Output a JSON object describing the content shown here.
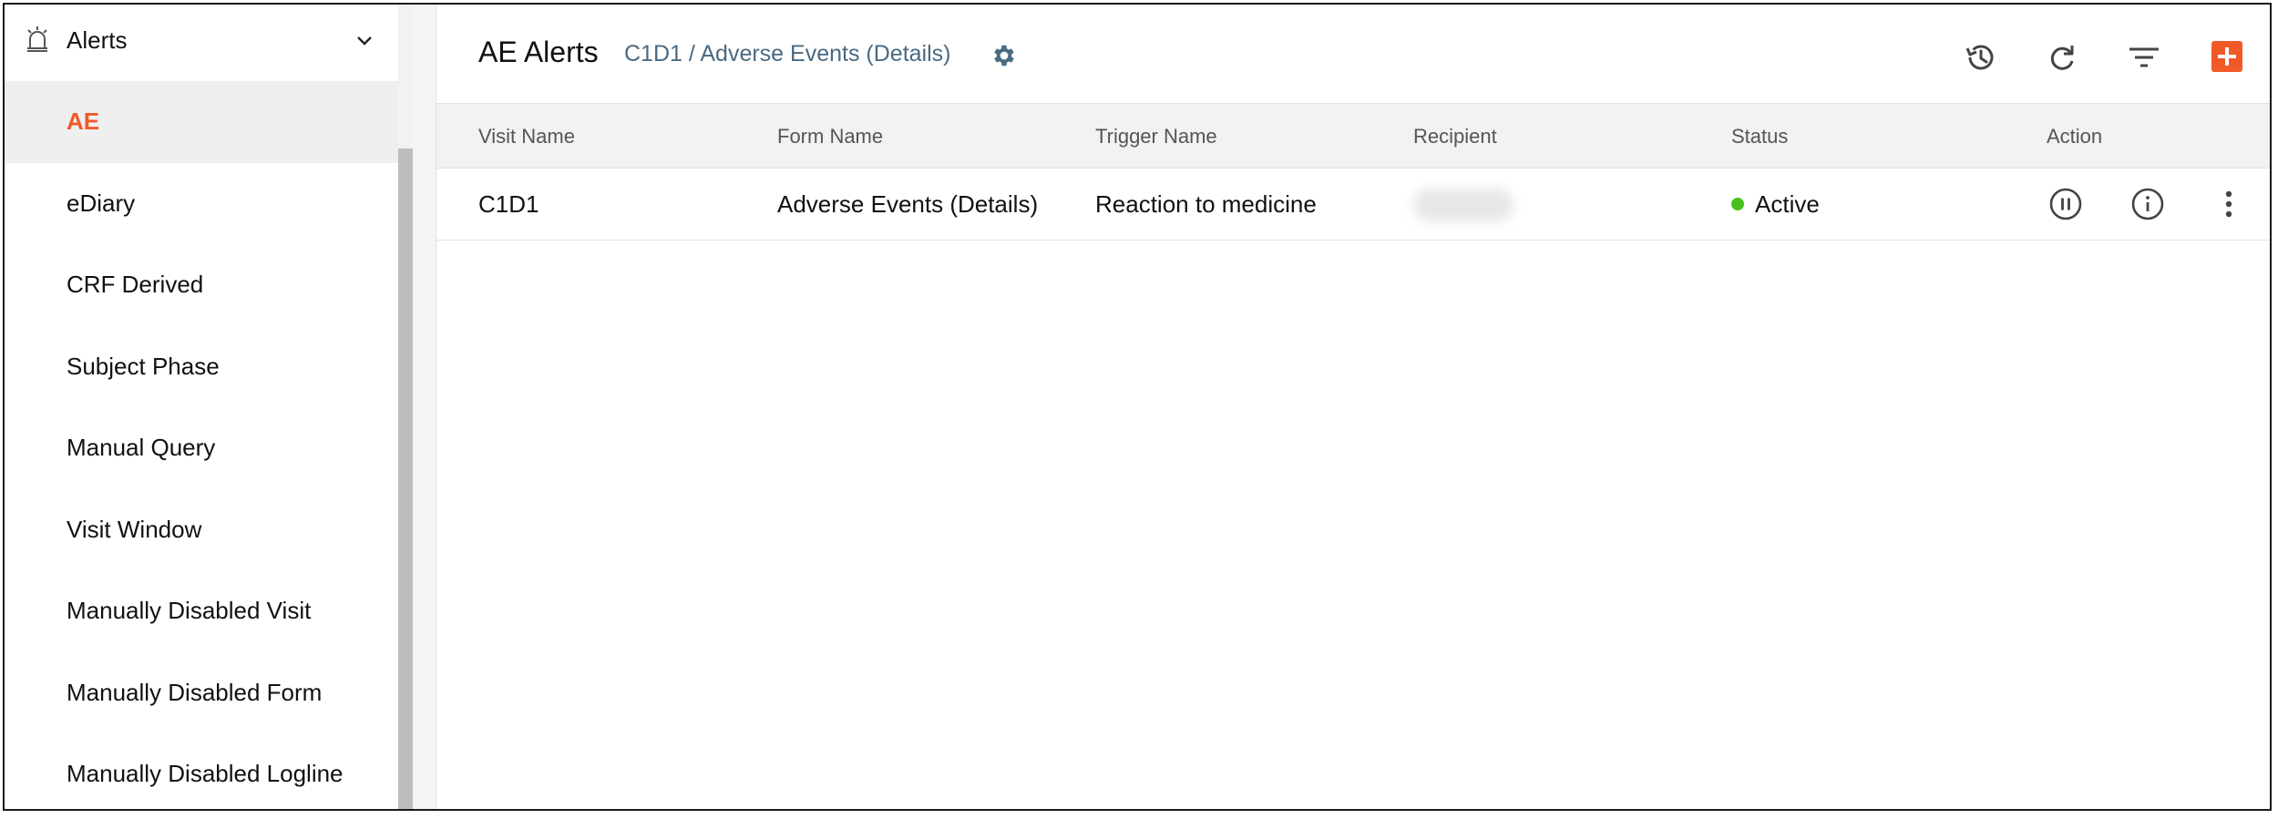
{
  "sidebar": {
    "header": {
      "title": "Alerts",
      "icon": "alarm-icon"
    },
    "items": [
      {
        "label": "AE",
        "active": true
      },
      {
        "label": "eDiary",
        "active": false
      },
      {
        "label": "CRF Derived",
        "active": false
      },
      {
        "label": "Subject Phase",
        "active": false
      },
      {
        "label": "Manual Query",
        "active": false
      },
      {
        "label": "Visit Window",
        "active": false
      },
      {
        "label": "Manually Disabled Visit",
        "active": false
      },
      {
        "label": "Manually Disabled Form",
        "active": false
      },
      {
        "label": "Manually Disabled Logline",
        "active": false
      }
    ]
  },
  "header": {
    "title": "AE Alerts",
    "breadcrumb": "C1D1 / Adverse Events (Details)",
    "toolbar": [
      "history-icon",
      "refresh-icon",
      "filter-icon",
      "add-icon"
    ]
  },
  "table": {
    "columns": [
      "Visit Name",
      "Form Name",
      "Trigger Name",
      "Recipient",
      "Status",
      "Action"
    ],
    "rows": [
      {
        "visit_name": "C1D1",
        "form_name": "Adverse Events (Details)",
        "trigger_name": "Reaction to medicine",
        "status": "Active",
        "actions": [
          "pause-icon",
          "info-icon",
          "more-vertical-icon"
        ]
      }
    ]
  },
  "colors": {
    "accent": "#f05a28",
    "status_active": "#43c21b",
    "breadcrumb": "#4a6a80"
  }
}
